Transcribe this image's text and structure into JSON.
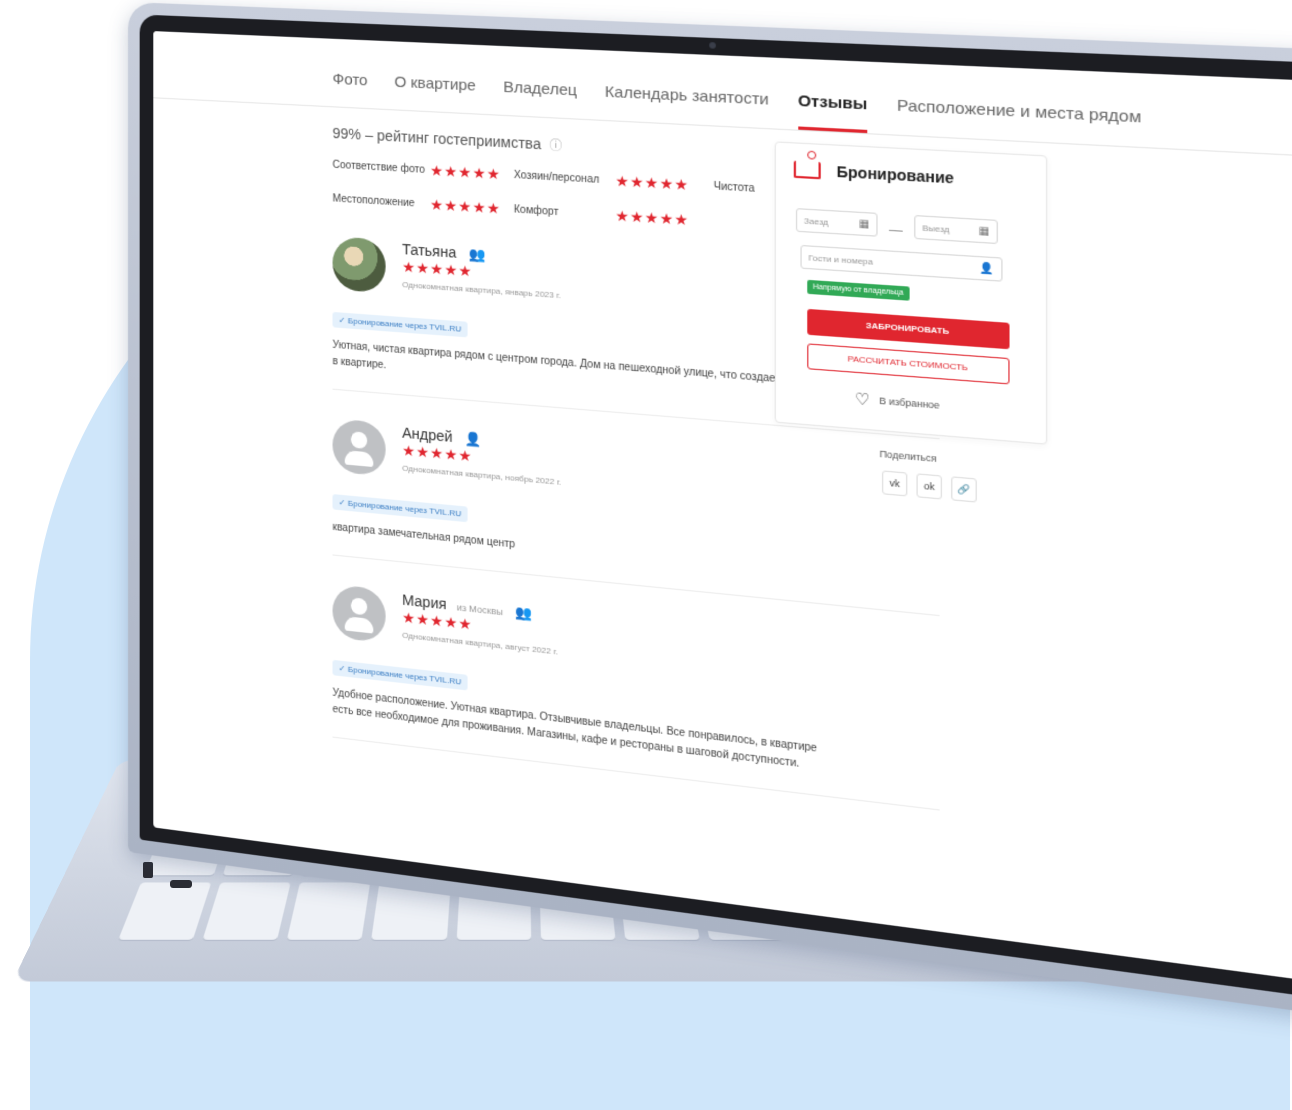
{
  "tabs": [
    {
      "label": "Фото"
    },
    {
      "label": "О квартире"
    },
    {
      "label": "Владелец"
    },
    {
      "label": "Календарь занятости"
    },
    {
      "label": "Отзывы"
    },
    {
      "label": "Расположение и места рядом"
    }
  ],
  "active_tab": "Отзывы",
  "rating": {
    "title": "99% – рейтинг гостеприимства",
    "info_icon": "ⓘ",
    "categories": [
      {
        "label": "Соответствие фото",
        "stars": "★★★★★"
      },
      {
        "label": "Хозяин/персонал",
        "stars": "★★★★★"
      },
      {
        "label": "Чистота",
        "stars": "★★★★★"
      },
      {
        "label": "Местоположение",
        "stars": "★★★★★"
      },
      {
        "label": "Комфорт",
        "stars": "★★★★★"
      }
    ]
  },
  "reviews": [
    {
      "name": "Татьяна",
      "guests_icon": "👥",
      "from": "",
      "stars": "★★★★★",
      "meta": "Однокомнатная квартира, январь 2023 г.",
      "badge": "✓ Бронирование через TVIL.RU",
      "text": "Уютная, чистая квартира рядом с центром города. Дом на пешеходной улице, что создает тишину в квартире."
    },
    {
      "name": "Андрей",
      "guests_icon": "👤",
      "from": "",
      "stars": "★★★★★",
      "meta": "Однокомнатная квартира, ноябрь 2022 г.",
      "badge": "✓ Бронирование через TVIL.RU",
      "text": "квартира замечательная рядом центр"
    },
    {
      "name": "Мария",
      "guests_icon": "👥",
      "from": "из Москвы",
      "stars": "★★★★★",
      "meta": "Однокомнатная квартира, август 2022 г.",
      "badge": "✓ Бронирование через TVIL.RU",
      "text": "Удобное расположение. Уютная квартира. Отзывчивые владельцы. Все понравилось, в квартире есть все необходимое для проживания. Магазины, кафе и рестораны в шаговой доступности."
    }
  ],
  "booking": {
    "title": "Бронирование",
    "checkin_placeholder": "Заезд",
    "checkout_placeholder": "Выезд",
    "dash": "—",
    "guests_placeholder": "Гости и номера",
    "direct_badge": "Напрямую от владельца",
    "book_button": "ЗАБРОНИРОВАТЬ",
    "calc_button": "РАССЧИТАТЬ СТОИМОСТЬ",
    "favorite_label": "В избранное",
    "calendar_icon": "▦",
    "user_icon": "👤",
    "heart_icon": "♡"
  },
  "share": {
    "label": "Поделиться",
    "icons": [
      "vk",
      "ok",
      "🔗"
    ]
  },
  "colors": {
    "accent": "#e0262f",
    "badge_blue": "#3c7fc4",
    "badge_green": "#31a956",
    "bg_blob": "#cfe6fa"
  }
}
